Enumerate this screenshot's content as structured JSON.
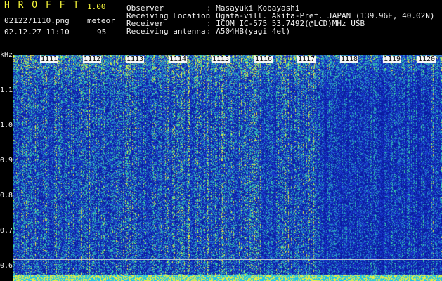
{
  "header": {
    "app_name": "H R O F F T",
    "version": "1.00",
    "filename": "0212271110.png",
    "mode_label": "meteor",
    "datetime": "02.12.27 11:10",
    "count": "95"
  },
  "info": {
    "rows": [
      {
        "label": "Observer",
        "value": ": Masayuki Kobayashi"
      },
      {
        "label": "Receiving Location",
        "value": ": Ogata-vill. Akita-Pref. JAPAN (139.96E, 40.02N)"
      },
      {
        "label": "Receiver",
        "value": ": ICOM IC-575 53.7492(@LCD)MHz USB"
      },
      {
        "label": "Receiving antenna",
        "value": ": A504HB(yagi 4el)"
      }
    ]
  },
  "spectrogram": {
    "unit_label": "kHz",
    "minute_labels": [
      "1111",
      "1112",
      "1113",
      "1114",
      "1115",
      "1116",
      "1117",
      "1118",
      "1119",
      "1120"
    ],
    "y_ticks": [
      "1.1",
      "1.0",
      "0.9",
      "0.8",
      "0.7",
      "0.6"
    ],
    "colors": {
      "background": "#0a1aa0",
      "noise_low": "#1c3cd0",
      "noise_mid": "#2aa0c8",
      "noise_high": "#40e0a0",
      "noise_peak": "#e8f040",
      "tick_bar": "#18c0f0"
    }
  }
}
